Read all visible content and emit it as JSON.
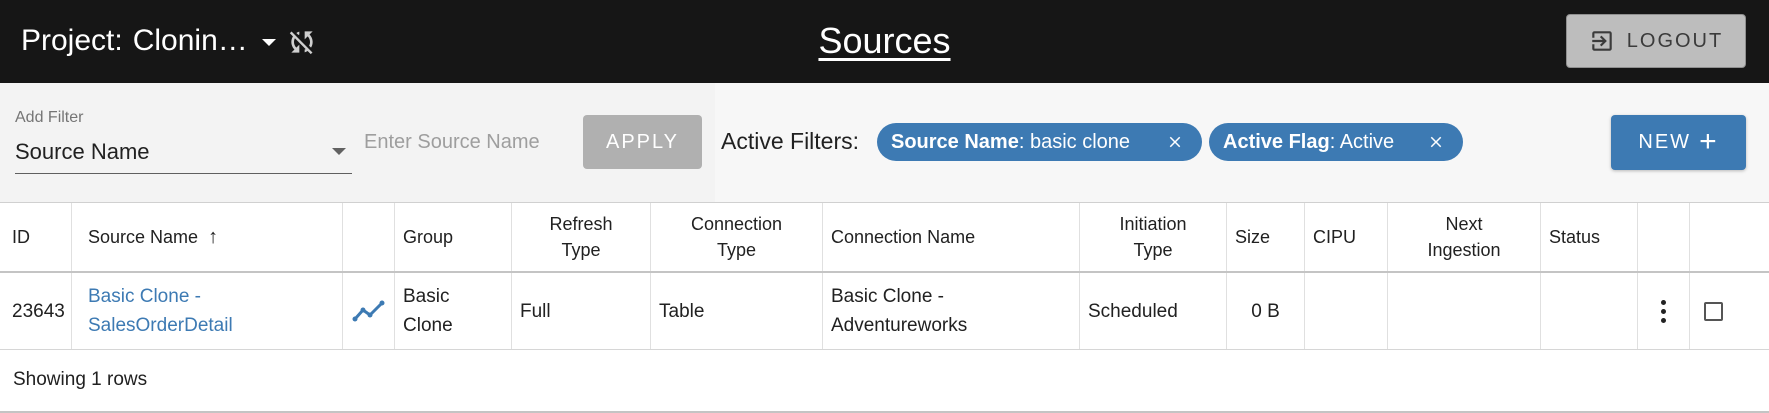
{
  "header": {
    "project_label": "Project:",
    "project_value": "Clonin…",
    "title": "Sources",
    "logout_label": "LOGOUT"
  },
  "filter": {
    "add_filter_label": "Add Filter",
    "selected_filter": "Source Name",
    "input_placeholder": "Enter Source Name",
    "input_value": "",
    "apply_label": "APPLY",
    "active_filters_label": "Active Filters:",
    "chips": [
      {
        "key": "Source Name",
        "value": ": basic clone"
      },
      {
        "key": "Active Flag",
        "value": ": Active"
      }
    ],
    "new_label": "NEW"
  },
  "table": {
    "headers": {
      "id": "ID",
      "source_name": "Source Name",
      "group": "Group",
      "refresh_type_1": "Refresh",
      "refresh_type_2": "Type",
      "connection_type_1": "Connection",
      "connection_type_2": "Type",
      "connection_name": "Connection Name",
      "initiation_type_1": "Initiation",
      "initiation_type_2": "Type",
      "size": "Size",
      "cipu": "CIPU",
      "next_ingestion_1": "Next",
      "next_ingestion_2": "Ingestion",
      "status": "Status"
    },
    "rows": [
      {
        "id": "23643",
        "source_name_1": "Basic Clone -",
        "source_name_2": "SalesOrderDetail",
        "group_1": "Basic",
        "group_2": "Clone",
        "refresh_type": "Full",
        "connection_type": "Table",
        "connection_name_1": "Basic Clone -",
        "connection_name_2": "Adventureworks",
        "initiation_type": "Scheduled",
        "size": "0 B",
        "cipu": "",
        "next_ingestion": "",
        "status": ""
      }
    ],
    "footer": "Showing 1 rows"
  },
  "colors": {
    "topbar": "#161616",
    "accent": "#3d7ab3",
    "apply_disabled": "#b0b0b0",
    "logout_bg": "#bdbdbd"
  },
  "icons": [
    "chevron-down-icon",
    "sync-disabled-icon",
    "logout-icon",
    "close-icon",
    "plus-icon",
    "arrow-up-icon",
    "trend-line-icon",
    "more-vert-icon",
    "checkbox-icon"
  ]
}
